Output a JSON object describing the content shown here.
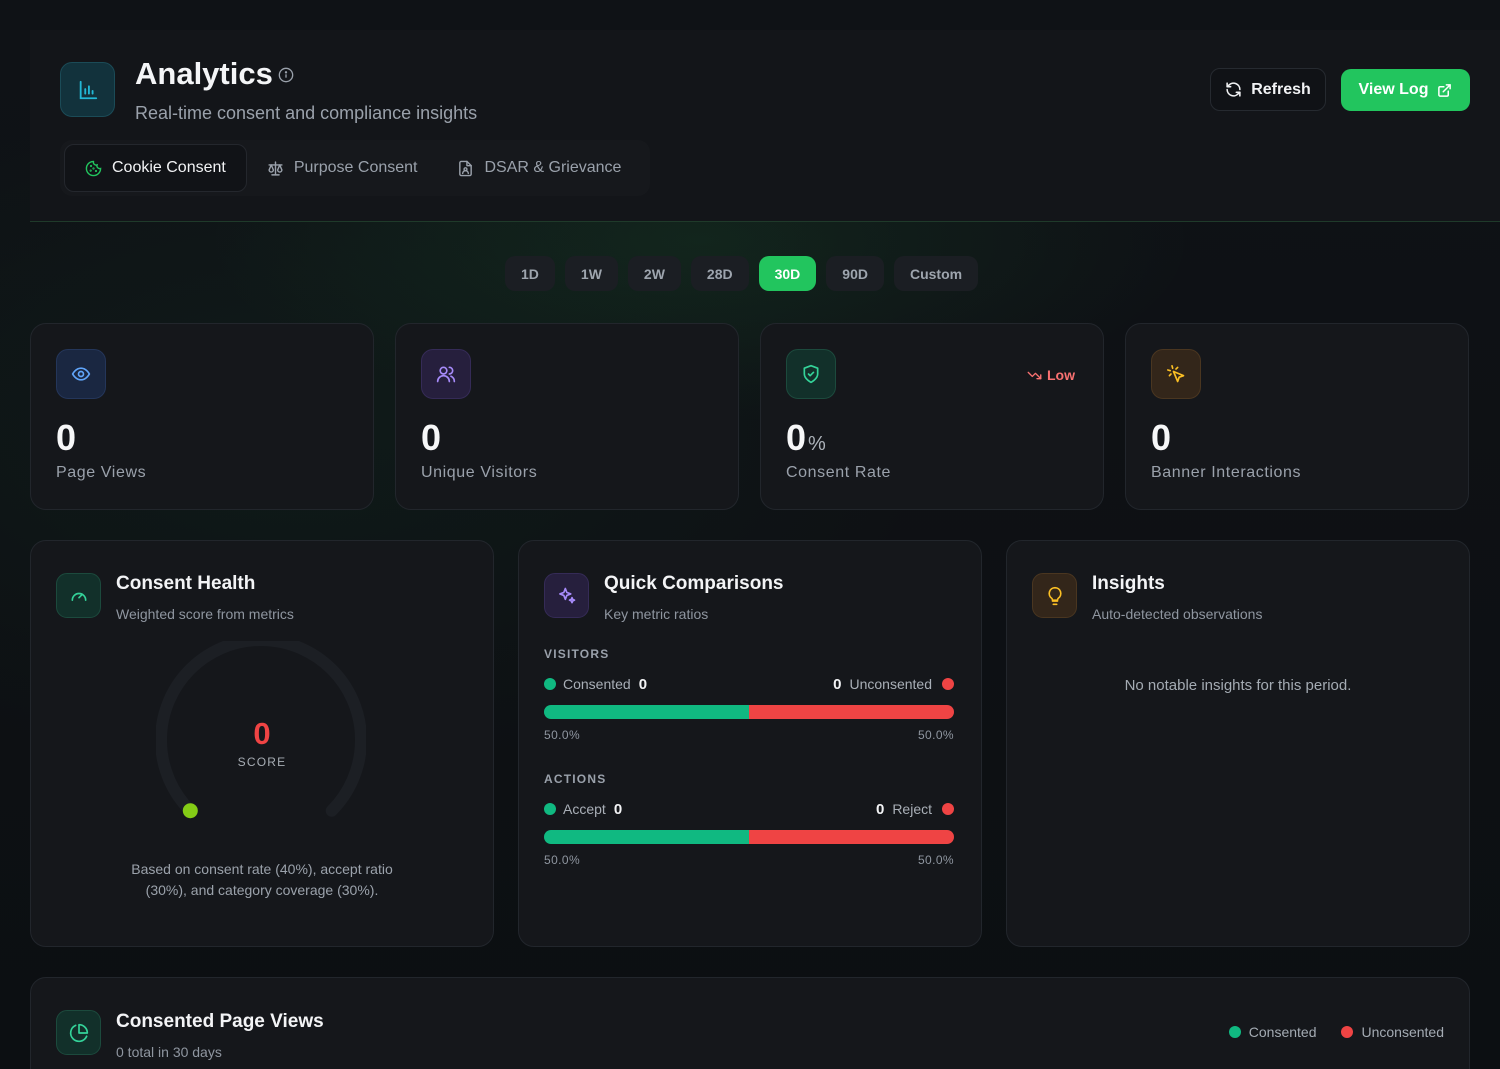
{
  "header": {
    "title": "Analytics",
    "subtitle": "Real-time consent and compliance insights",
    "refresh_label": "Refresh",
    "view_log_label": "View Log",
    "icons": [
      "bar-chart-icon",
      "info-icon",
      "refresh-icon",
      "external-link-icon"
    ]
  },
  "tabs": [
    {
      "label": "Cookie Consent",
      "icon": "cookie-icon",
      "active": true
    },
    {
      "label": "Purpose Consent",
      "icon": "scale-icon",
      "active": false
    },
    {
      "label": "DSAR & Grievance",
      "icon": "file-user-icon",
      "active": false
    }
  ],
  "ranges": [
    {
      "label": "1D",
      "active": false
    },
    {
      "label": "1W",
      "active": false
    },
    {
      "label": "2W",
      "active": false
    },
    {
      "label": "28D",
      "active": false
    },
    {
      "label": "30D",
      "active": true
    },
    {
      "label": "90D",
      "active": false
    },
    {
      "label": "Custom",
      "active": false
    }
  ],
  "stats": [
    {
      "value": "0",
      "label": "Page Views",
      "icon": "eye-icon",
      "color": "#60a5fa"
    },
    {
      "value": "0",
      "label": "Unique Visitors",
      "icon": "users-icon",
      "color": "#a78bfa"
    },
    {
      "value": "0",
      "unit": "%",
      "label": "Consent Rate",
      "icon": "shield-check-icon",
      "color": "#34d399",
      "trend": "Low"
    },
    {
      "value": "0",
      "label": "Banner Interactions",
      "icon": "pointer-click-icon",
      "color": "#fbbf24"
    }
  ],
  "health": {
    "title": "Consent Health",
    "subtitle": "Weighted score from metrics",
    "score": "0",
    "score_label": "SCORE",
    "score_fraction": 0,
    "note": "Based on consent rate (40%), accept ratio (30%), and category coverage (30%).",
    "icon": "gauge-icon"
  },
  "comparisons": {
    "title": "Quick Comparisons",
    "subtitle": "Key metric ratios",
    "icon": "sparkles-icon",
    "visitors": {
      "label": "VISITORS",
      "left_label": "Consented",
      "left_value": "0",
      "right_label": "Unconsented",
      "right_value": "0",
      "left_pct": "50.0%",
      "right_pct": "50.0%",
      "left_fraction": 0.5
    },
    "actions": {
      "label": "ACTIONS",
      "left_label": "Accept",
      "left_value": "0",
      "right_label": "Reject",
      "right_value": "0",
      "left_pct": "50.0%",
      "right_pct": "50.0%",
      "left_fraction": 0.5
    }
  },
  "insights": {
    "title": "Insights",
    "subtitle": "Auto-detected observations",
    "empty": "No notable insights for this period.",
    "icon": "lightbulb-icon"
  },
  "page_views": {
    "title": "Consented Page Views",
    "subtitle": "0 total in 30 days",
    "icon": "pie-chart-icon",
    "legend": [
      {
        "label": "Consented",
        "color": "#10b981"
      },
      {
        "label": "Unconsented",
        "color": "#ef4444"
      }
    ]
  },
  "colors": {
    "accent": "#22c55e",
    "danger": "#ef4444",
    "success": "#10b981"
  }
}
